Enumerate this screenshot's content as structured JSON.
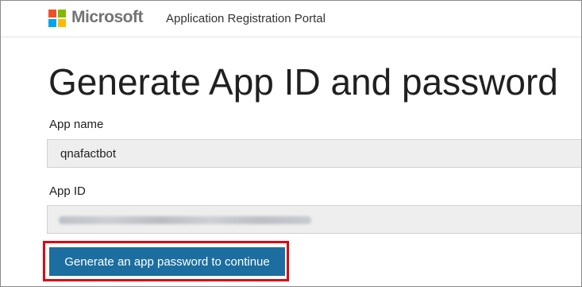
{
  "header": {
    "brand": "Microsoft",
    "portal_title": "Application Registration Portal",
    "logo_colors": [
      "#f25022",
      "#7fba00",
      "#00a4ef",
      "#ffb900"
    ]
  },
  "page": {
    "title": "Generate App ID and password"
  },
  "app_name": {
    "label": "App name",
    "value": "qnafactbot"
  },
  "app_id": {
    "label": "App ID",
    "value_obscured": true
  },
  "actions": {
    "generate_button_label": "Generate an app password to continue",
    "button_color": "#1b6e9f",
    "highlight_color": "#e1000f"
  }
}
